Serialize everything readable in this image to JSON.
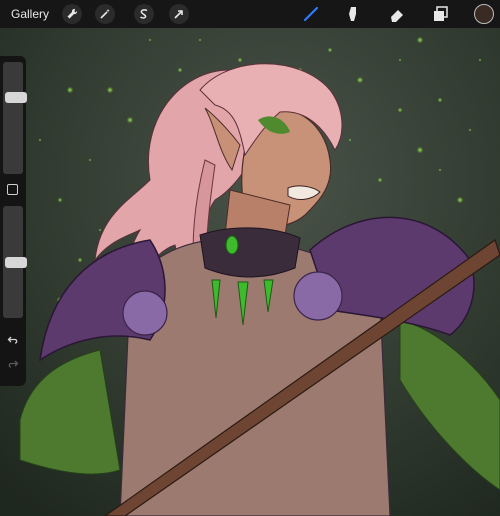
{
  "toolbar": {
    "gallery_label": "Gallery",
    "left_tools": [
      "wrench-icon",
      "magic-wand-icon",
      "selection-s-icon",
      "transform-arrow-icon"
    ],
    "right_tools": [
      "brush-icon",
      "smudge-icon",
      "eraser-icon",
      "layers-icon"
    ],
    "active_tool": "brush",
    "active_color": "#3a2a24",
    "accent": "#2f7bff"
  },
  "sidebar": {
    "brush_size_level": 0.3,
    "opacity_level": 0.5,
    "modify_button": "square-icon",
    "undo": "undo-icon",
    "redo": "redo-icon"
  },
  "canvas": {
    "subject": "illustration-elf-warrior",
    "palette": {
      "background": "#2f3b2e",
      "hair": "#e2a5a9",
      "skin": "#c79278",
      "armor": "#5d3a6d",
      "tunic": "#9c7a70",
      "scales": "#4e7a2f",
      "gems": "#3dbb2d",
      "staff": "#6e4533",
      "sparkles": "#79d13a"
    }
  }
}
